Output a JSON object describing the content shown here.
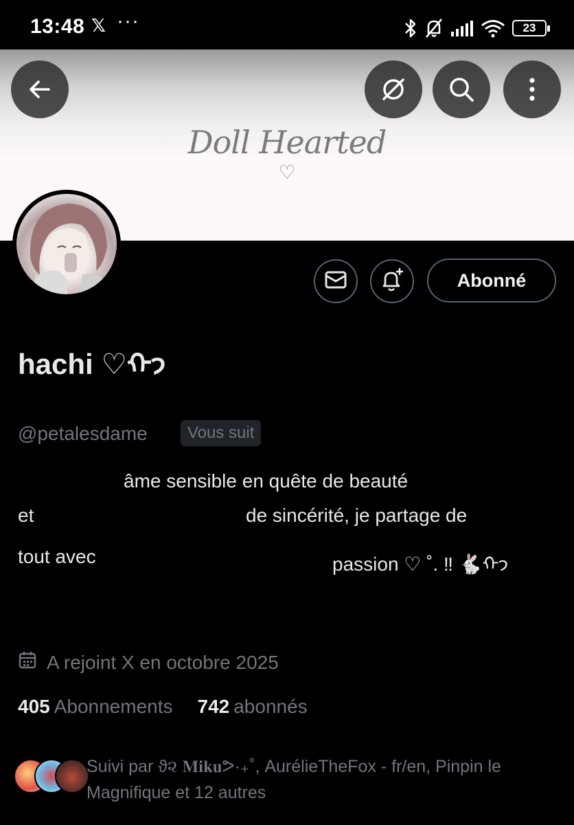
{
  "status_bar": {
    "time": "13:48",
    "x_logo": "𝕏",
    "dots": "···",
    "battery": "23",
    "icons": [
      "bluetooth-icon",
      "mute-bell-icon",
      "signal-icon",
      "wifi-icon",
      "battery-icon"
    ]
  },
  "banner": {
    "title": "Doll Hearted",
    "heart": "♡"
  },
  "header_icons": [
    "back-arrow-icon",
    "grok-icon",
    "search-icon",
    "more-vertical-icon"
  ],
  "actions": {
    "message_icon": "envelope-icon",
    "notify_icon": "bell-plus-icon",
    "follow_label": "Abonné"
  },
  "profile": {
    "name": "hachi ♡ᡣ𐭩",
    "handle": "@petalesdame",
    "follows_you": "Vous suit",
    "bio": [
      "âme sensible en quête de beauté",
      "et",
      "de sincérité, je partage de",
      "tout avec",
      "passion ♡ ˚. ‼ 🐇ᡣ𐭩"
    ],
    "joined": "A rejoint X en octobre 2025"
  },
  "stats": {
    "following_count": "405",
    "following_label": "Abonnements",
    "followers_count": "742",
    "followers_label": "abonnés"
  },
  "followed_by": {
    "text": "Suivi par ϑ૨ 𝐌𝐢𝐤𝐮ᕗ·₊˚, AurélieTheFox - fr/en, Pinpin le Magnifique et 12 autres"
  },
  "colors": {
    "background": "#000000",
    "text_primary": "#e7e9ea",
    "text_secondary": "#71767b",
    "border": "#536471"
  }
}
